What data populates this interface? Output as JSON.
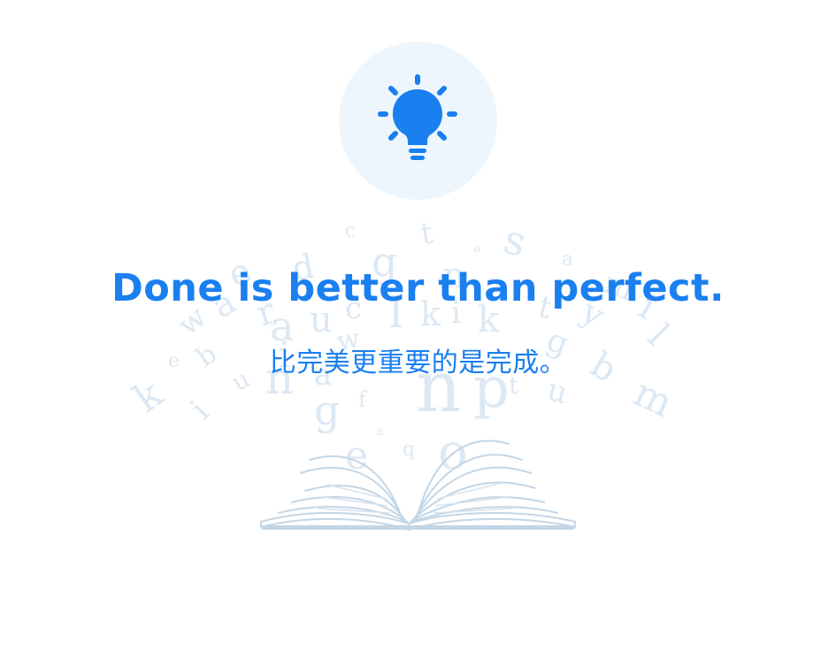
{
  "icon": "lightbulb-icon",
  "decoration": "open-book-with-floating-letters",
  "quote": {
    "english": "Done is better than perfect.",
    "chinese": "比完美更重要的是完成。"
  },
  "colors": {
    "accent": "#1a7fef",
    "icon_background": "#eef6fd",
    "decoration": "#c3d6e6"
  }
}
